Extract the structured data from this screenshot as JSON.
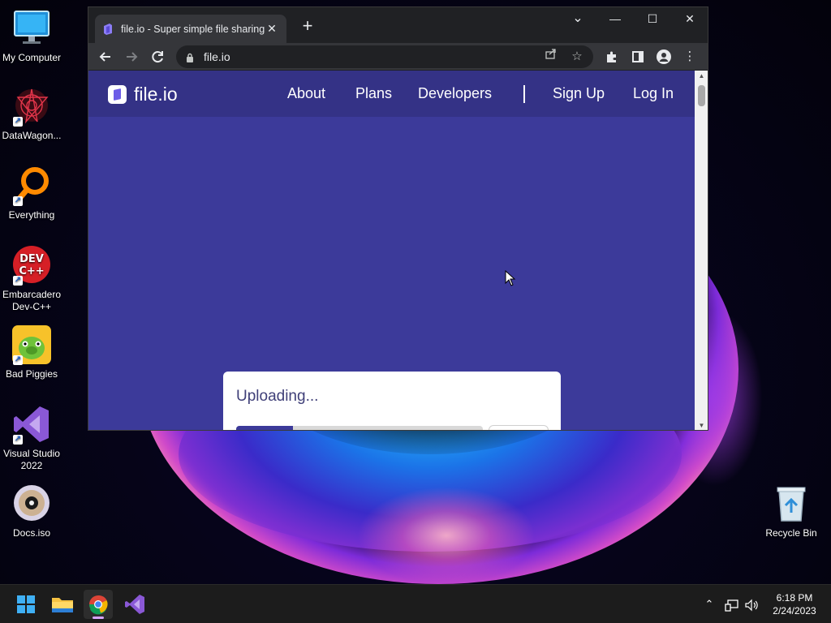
{
  "desktop": {
    "icons": [
      {
        "label": "My Computer",
        "icon": "monitor-icon"
      },
      {
        "label": "DataWagon...",
        "icon": "datawagon-icon"
      },
      {
        "label": "Everything",
        "icon": "everything-search-icon"
      },
      {
        "label": "Embarcadero Dev-C++",
        "icon": "devcpp-icon"
      },
      {
        "label": "Bad Piggies",
        "icon": "bad-piggies-icon"
      },
      {
        "label": "Visual Studio 2022",
        "icon": "visual-studio-icon"
      },
      {
        "label": "Docs.iso",
        "icon": "disc-image-icon"
      },
      {
        "label": "Recycle Bin",
        "icon": "recycle-bin-icon"
      }
    ]
  },
  "browser": {
    "tab_title": "file.io - Super simple file sharing",
    "url": "file.io",
    "controls": {
      "minimize": "—",
      "maximize": "☐",
      "close": "✕",
      "tab_search": "⌄",
      "new_tab": "+",
      "tab_close": "✕"
    }
  },
  "site": {
    "brand": "file.io",
    "nav": [
      "About",
      "Plans",
      "Developers",
      "Sign Up",
      "Log In"
    ],
    "upload": {
      "heading": "Uploading...",
      "progress": 0.23
    }
  },
  "taskbar": {
    "apps": [
      "windows-start-icon",
      "file-explorer-icon",
      "chrome-icon",
      "visual-studio-icon"
    ],
    "time": "6:18 PM",
    "date": "2/24/2023"
  },
  "colors": {
    "site_bg": "#3c3a9a",
    "site_header": "#343286",
    "chrome_dark": "#202124",
    "chrome_toolbar": "#35363a"
  }
}
